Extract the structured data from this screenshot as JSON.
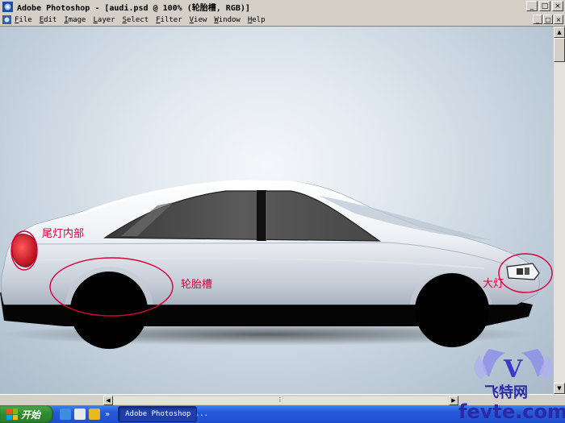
{
  "window": {
    "title": "Adobe Photoshop - [audi.psd @ 100% (轮胎槽, RGB)]",
    "controls": [
      "_",
      "□",
      "×"
    ]
  },
  "menu": {
    "items": [
      "File",
      "Edit",
      "Image",
      "Layer",
      "Select",
      "Filter",
      "View",
      "Window",
      "Help"
    ],
    "doc_controls": [
      "_",
      "□",
      "×"
    ]
  },
  "annotations": {
    "taillight": "尾灯内部",
    "wheel_well": "轮胎槽",
    "headlight": "大灯"
  },
  "colors": {
    "annotation": "#d8003a",
    "taskbar": "#2459d8",
    "start": "#2f8a2f"
  },
  "taskbar": {
    "start_label": "开始",
    "quicklaunch_more": "»",
    "task_label": "Adobe Photoshop ..."
  },
  "watermark": {
    "brand": "飞特网",
    "domain": "fevte.com",
    "letter": "V"
  }
}
